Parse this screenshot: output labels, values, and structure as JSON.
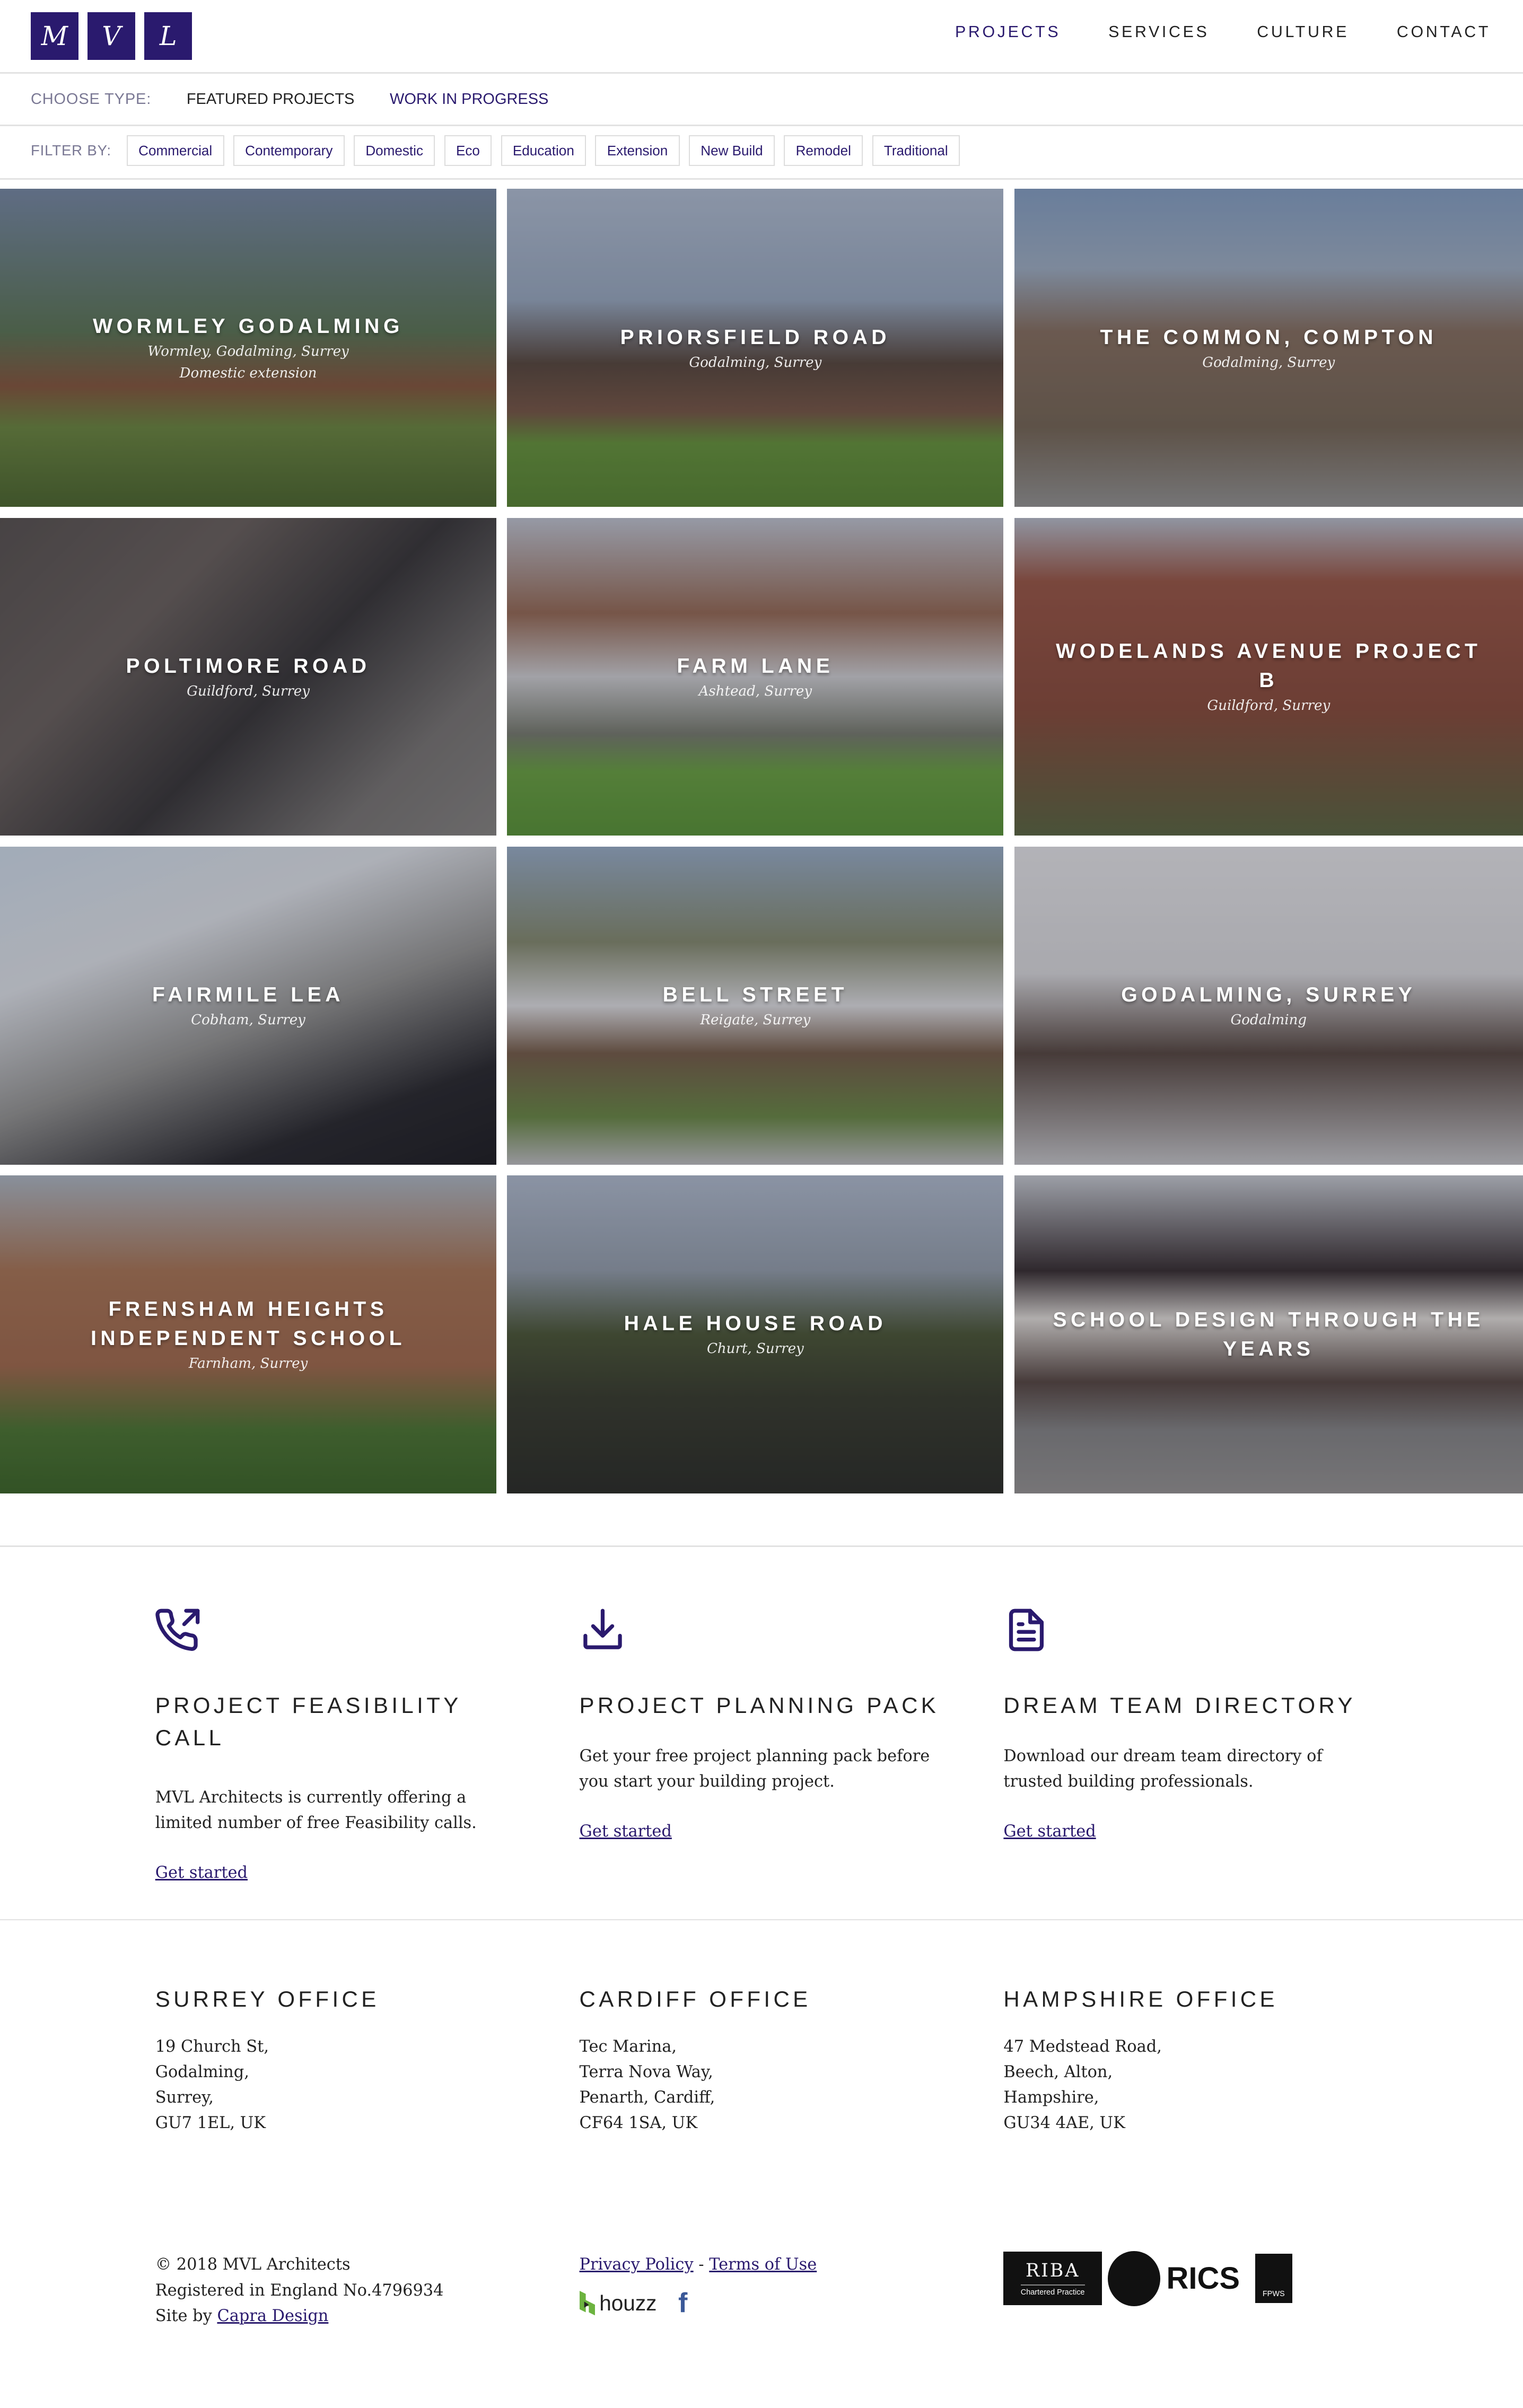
{
  "header": {
    "logo_letters": [
      "M",
      "V",
      "L"
    ],
    "nav": [
      {
        "label": "PROJECTS",
        "active": true
      },
      {
        "label": "SERVICES"
      },
      {
        "label": "CULTURE"
      },
      {
        "label": "CONTACT"
      }
    ]
  },
  "type_bar": {
    "label": "CHOOSE TYPE:",
    "options": [
      "FEATURED PROJECTS",
      "WORK IN PROGRESS"
    ]
  },
  "filter_bar": {
    "label": "FILTER BY:",
    "chips": [
      "Commercial",
      "Contemporary",
      "Domestic",
      "Eco",
      "Education",
      "Extension",
      "New Build",
      "Remodel",
      "Traditional"
    ]
  },
  "projects": [
    {
      "title": "WORMLEY GODALMING",
      "subtitle": "Wormley, Godalming, Surrey",
      "subtitle2": "Domestic extension"
    },
    {
      "title": "PRIORSFIELD ROAD",
      "subtitle": "Godalming, Surrey"
    },
    {
      "title": "THE COMMON, COMPTON",
      "subtitle": "Godalming, Surrey"
    },
    {
      "title": "POLTIMORE ROAD",
      "subtitle": "Guildford, Surrey"
    },
    {
      "title": "FARM LANE",
      "subtitle": "Ashtead, Surrey"
    },
    {
      "title": "WODELANDS AVENUE PROJECT B",
      "subtitle": "Guildford, Surrey"
    },
    {
      "title": "FAIRMILE LEA",
      "subtitle": "Cobham, Surrey"
    },
    {
      "title": "BELL STREET",
      "subtitle": "Reigate, Surrey"
    },
    {
      "title": "GODALMING, SURREY",
      "subtitle": "Godalming"
    },
    {
      "title": "FRENSHAM HEIGHTS INDEPENDENT SCHOOL",
      "subtitle": "Farnham, Surrey"
    },
    {
      "title": "HALE HOUSE ROAD",
      "subtitle": "Churt, Surrey"
    },
    {
      "title": "SCHOOL DESIGN THROUGH THE YEARS",
      "subtitle": ""
    }
  ],
  "cta": [
    {
      "icon": "phone-outgoing-icon",
      "title": "PROJECT FEASIBILITY CALL",
      "text": "MVL Architects is currently offering a limited number of free Feasibility calls.",
      "link": "Get started"
    },
    {
      "icon": "download-icon",
      "title": "PROJECT PLANNING PACK",
      "text": "Get your free project planning pack before you start your building project.",
      "link": "Get started"
    },
    {
      "icon": "document-icon",
      "title": "DREAM TEAM DIRECTORY",
      "text": "Download our dream team directory of trusted building professionals.",
      "link": "Get started"
    }
  ],
  "offices": [
    {
      "title": "SURREY OFFICE",
      "lines": [
        "19 Church St,",
        "Godalming,",
        "Surrey,",
        "GU7 1EL, UK"
      ]
    },
    {
      "title": "CARDIFF OFFICE",
      "lines": [
        "Tec Marina,",
        "Terra Nova Way,",
        "Penarth, Cardiff,",
        "CF64 1SA, UK"
      ]
    },
    {
      "title": "HAMPSHIRE OFFICE",
      "lines": [
        "47 Medstead Road,",
        "Beech, Alton,",
        "Hampshire,",
        "GU34 4AE, UK"
      ]
    }
  ],
  "footer": {
    "copyright": "© 2018 MVL Architects",
    "registered": "Registered in England No.4796934",
    "site_by": "Site by ",
    "site_by_link": "Capra Design",
    "privacy": "Privacy Policy",
    "sep": " - ",
    "terms": "Terms of Use",
    "houzz": "houzz",
    "riba": "RIBA",
    "riba_sub": "Chartered Practice",
    "rics": "RICS",
    "fpws": "FPWS"
  },
  "colors": {
    "brand": "#2a1a6e"
  }
}
